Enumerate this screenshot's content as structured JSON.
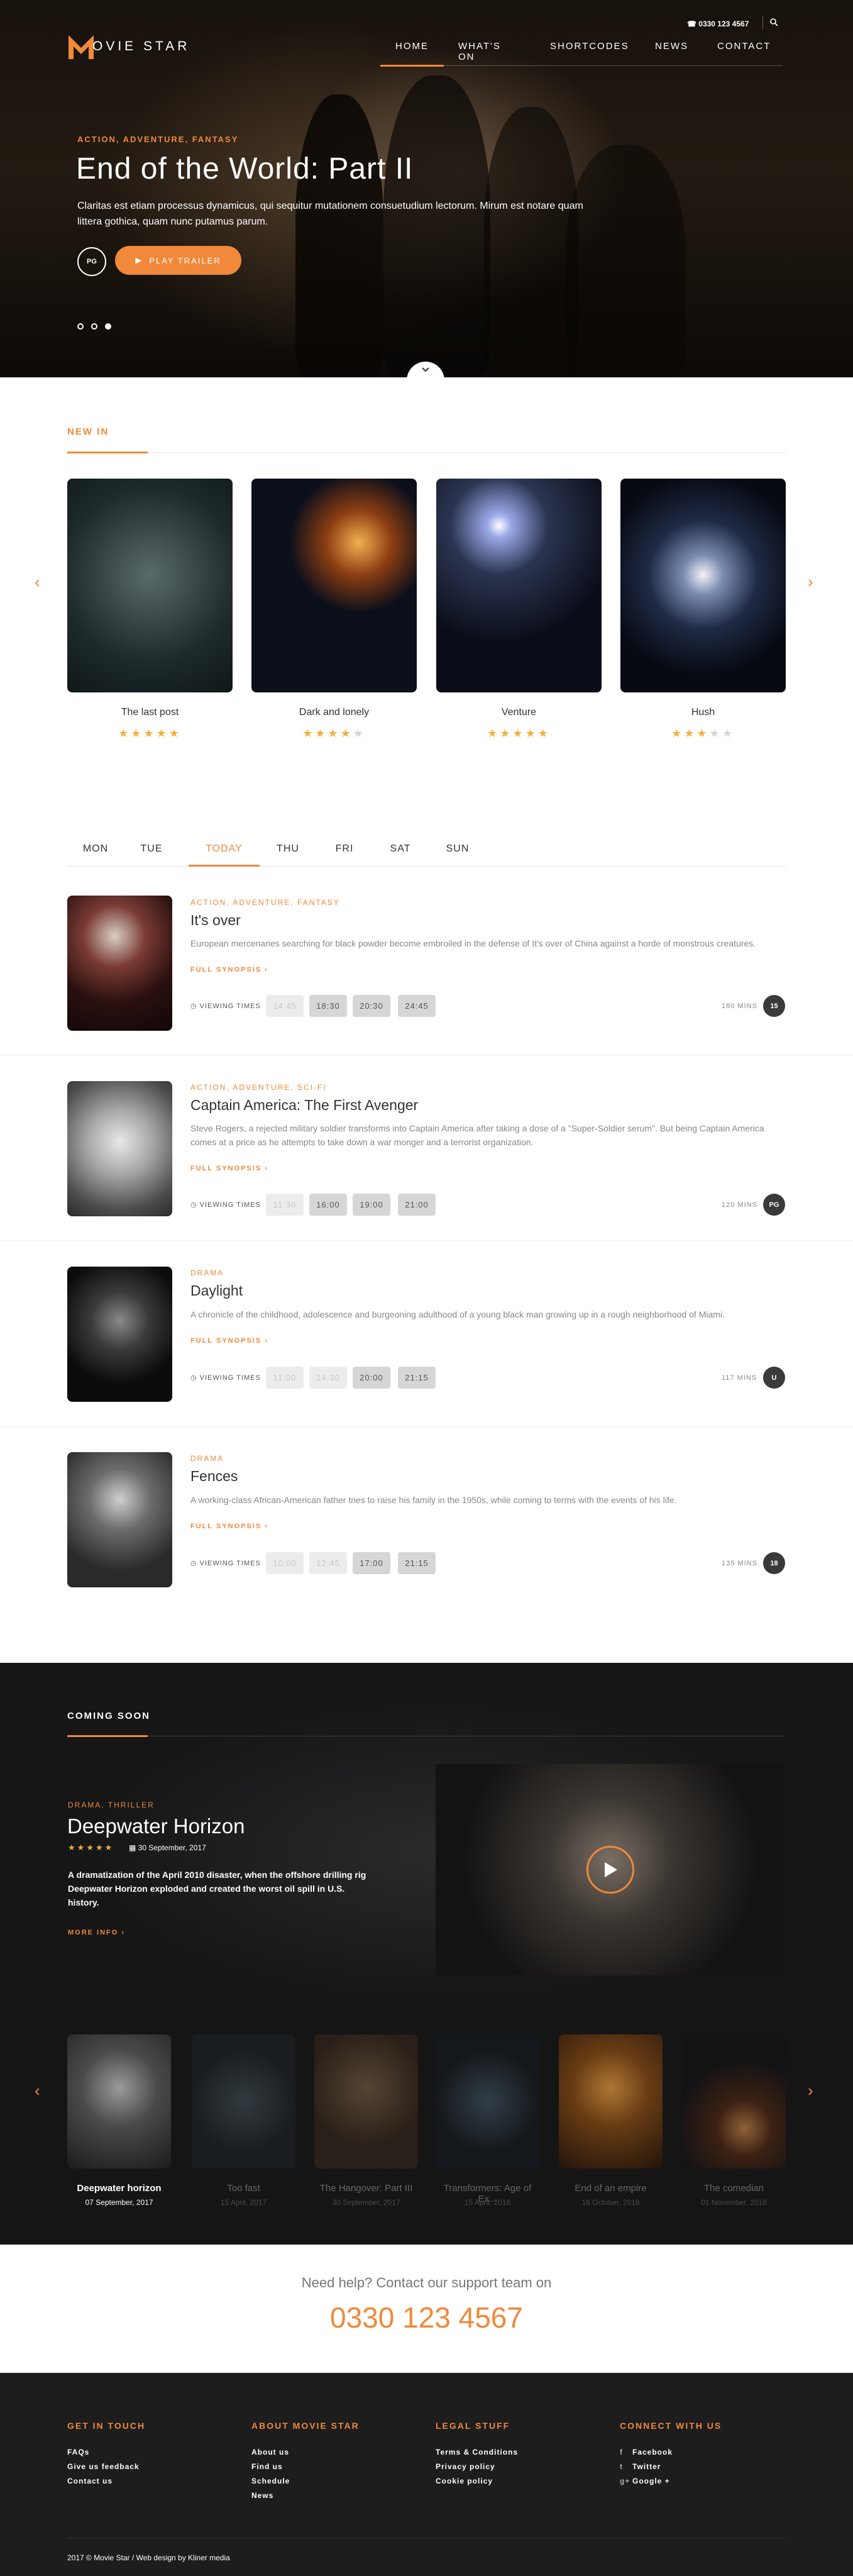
{
  "header": {
    "phone": "0330 123 4567",
    "logo_text": "OVIE STAR",
    "nav": [
      "HOME",
      "WHAT'S ON",
      "SHORTCODES",
      "NEWS",
      "CONTACT"
    ],
    "active_nav": "HOME"
  },
  "hero": {
    "genres": "ACTION, ADVENTURE, FANTASY",
    "title": "End of the World: Part II",
    "description": "Claritas est etiam processus dynamicus, qui sequitur mutationem consuetudium lectorum. Mirum est notare quam littera gothica, quam nunc putamus parum.",
    "rating": "PG",
    "play_label": "PLAY TRAILER",
    "slides": 3,
    "active_slide": 3
  },
  "new_in": {
    "heading": "NEW IN",
    "movies": [
      {
        "title": "The last post",
        "stars": 5
      },
      {
        "title": "Dark and lonely",
        "stars": 4
      },
      {
        "title": "Venture",
        "stars": 5
      },
      {
        "title": "Hush",
        "stars": 3
      }
    ]
  },
  "schedule": {
    "days": [
      "MON",
      "TUE",
      "TODAY",
      "THU",
      "FRI",
      "SAT",
      "SUN"
    ],
    "active_day": "TODAY",
    "viewing_label": "VIEWING TIMES",
    "synopsis_label": "FULL SYNOPSIS",
    "listings": [
      {
        "genres": "ACTION, ADVENTURE, FANTASY",
        "title": "It's over",
        "description": "European mercenaries searching for black powder become embroiled in the defense of It's over of China against a horde of monstrous creatures.",
        "times": [
          "14:45",
          "18:30",
          "20:30",
          "24:45"
        ],
        "past": 1,
        "mins": "180 MINS",
        "rating": "15"
      },
      {
        "genres": "ACTION, ADVENTURE, SCI-FI",
        "title": "Captain America: The First Avenger",
        "description": "Steve Rogers, a rejected military soldier transforms into Captain America after taking a dose of a \"Super-Soldier serum\". But being Captain America comes at a price as he attempts to take down a war monger and a terrorist organization.",
        "times": [
          "11:30",
          "16:00",
          "19:00",
          "21:00"
        ],
        "past": 1,
        "mins": "120 MINS",
        "rating": "PG"
      },
      {
        "genres": "DRAMA",
        "title": "Daylight",
        "description": "A chronicle of the childhood, adolescence and burgeoning adulthood of a young black man growing up in a rough neighborhood of Miami.",
        "times": [
          "11:00",
          "14:30",
          "20:00",
          "21:15"
        ],
        "past": 2,
        "mins": "117 MINS",
        "rating": "U"
      },
      {
        "genres": "DRAMA",
        "title": "Fences",
        "description": "A working-class African-American father tries to raise his family in the 1950s, while coming to terms with the events of his life.",
        "times": [
          "10:00",
          "12:45",
          "17:00",
          "21:15"
        ],
        "past": 2,
        "mins": "135 MINS",
        "rating": "18"
      }
    ]
  },
  "coming_soon": {
    "heading": "COMING SOON",
    "featured": {
      "genres": "DRAMA, THRILLER",
      "title": "Deepwater Horizon",
      "stars": 5,
      "date": "30 September, 2017",
      "description": "A dramatization of the April 2010 disaster, when the offshore drilling rig Deepwater Horizon exploded and created the worst oil spill in U.S. history.",
      "more": "MORE INFO"
    },
    "strip": [
      {
        "title": "Deepwater horizon",
        "date": "07 September, 2017"
      },
      {
        "title": "Too fast",
        "date": "15 April, 2017"
      },
      {
        "title": "The Hangover: Part III",
        "date": "30 September, 2017"
      },
      {
        "title": "Transformers: Age of Ex...",
        "date": "15 April, 2018"
      },
      {
        "title": "End of an empire",
        "date": "16 October, 2018"
      },
      {
        "title": "The comedian",
        "date": "01 November, 2018"
      }
    ]
  },
  "support": {
    "question": "Need help? Contact our support team on",
    "phone": "0330 123 4567"
  },
  "footer": {
    "columns": [
      {
        "heading": "GET IN TOUCH",
        "links": [
          "FAQs",
          "Give us feedback",
          "Contact us"
        ]
      },
      {
        "heading": "ABOUT MOVIE STAR",
        "links": [
          "About us",
          "Find us",
          "Schedule",
          "News"
        ]
      },
      {
        "heading": "LEGAL STUFF",
        "links": [
          "Terms & Conditions",
          "Privacy policy",
          "Cookie policy"
        ]
      },
      {
        "heading": "CONNECT WITH US",
        "links": [
          "Facebook",
          "Twitter",
          "Google +"
        ]
      }
    ],
    "copyright": "2017 © Movie Star / Web design by Kliner media"
  },
  "colors": {
    "accent": "#f0893a",
    "dark": "#1d1d1e",
    "text": "#333333"
  }
}
